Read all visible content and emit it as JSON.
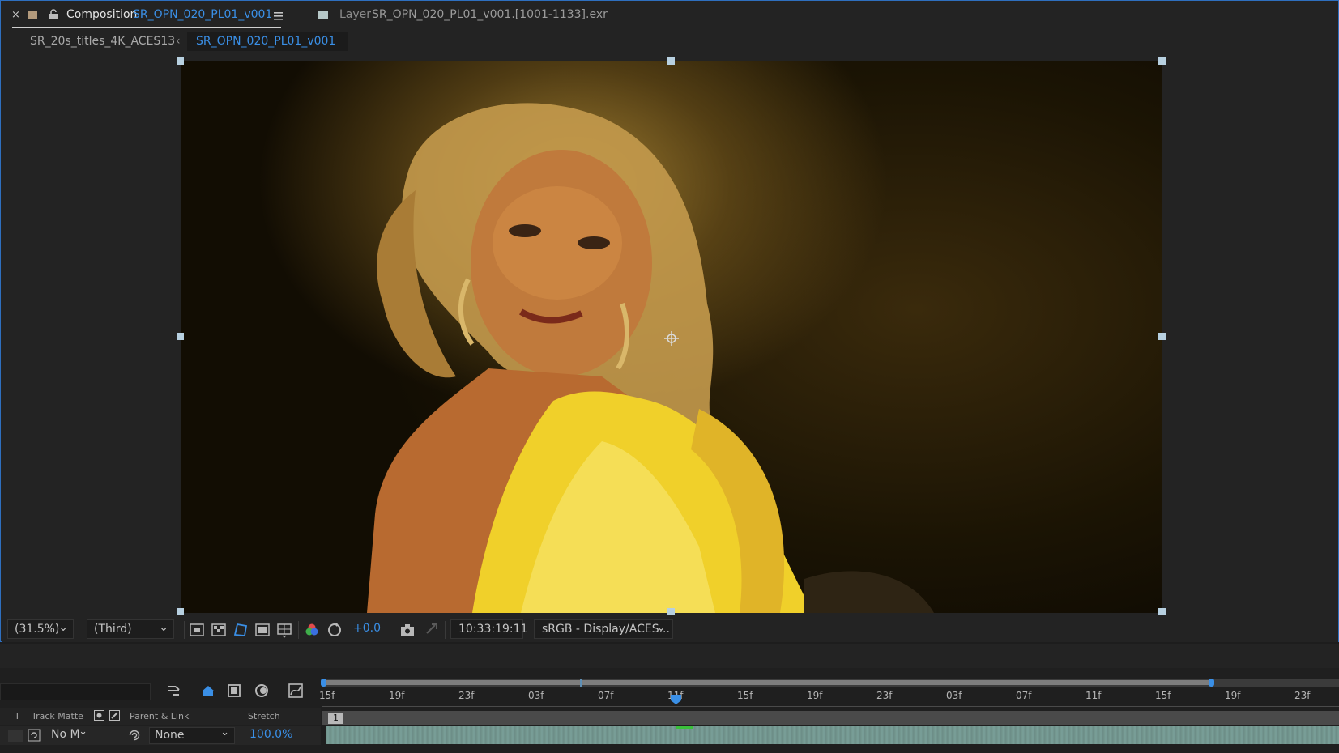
{
  "colors": {
    "accent": "#3a8fe6",
    "panel_bg": "#232323",
    "comp_swatch": "#b39a7c",
    "layer_swatch": "#b6c8c8"
  },
  "header": {
    "close_glyph": "×",
    "comp_label": "Composition",
    "comp_name": "SR_OPN_020_PL01_v001",
    "menu_icon": "hamburger-menu-icon",
    "layer_label": "Layer",
    "layer_name": "SR_OPN_020_PL01_v001.[1001-1133].exr"
  },
  "breadcrumb": {
    "parent": "SR_20s_titles_4K_ACES13",
    "chevron": "‹",
    "current": "SR_OPN_020_PL01_v001"
  },
  "viewer": {
    "footage_description": "",
    "icons": [
      "anchor-point-icon"
    ]
  },
  "toolbar": {
    "zoom": "(31.5%)",
    "resolution": "(Third)",
    "exposure": "+0.0",
    "timecode": "10:33:19:11",
    "color_management": "sRGB - Display/ACES...",
    "icons": [
      "region-of-interest-icon",
      "transparency-grid-icon",
      "mask-path-visibility-icon",
      "toggle-guides-icon",
      "grid-overlay-icon",
      "show-channel-icon",
      "reset-exposure-icon",
      "snapshot-camera-icon",
      "show-snapshot-icon"
    ]
  },
  "timeline": {
    "ruler_labels": [
      "15f",
      "19f",
      "23f",
      "03f",
      "07f",
      "11f",
      "15f",
      "19f",
      "23f",
      "03f",
      "07f",
      "11f",
      "15f",
      "19f",
      "23f"
    ],
    "columns": {
      "t": "T",
      "track_matte": "Track Matte",
      "parent_link": "Parent & Link",
      "stretch": "Stretch"
    },
    "layer": {
      "number": "1",
      "track_matte_value": "No M",
      "parent_value": "None",
      "stretch_value": "100.0%"
    }
  }
}
